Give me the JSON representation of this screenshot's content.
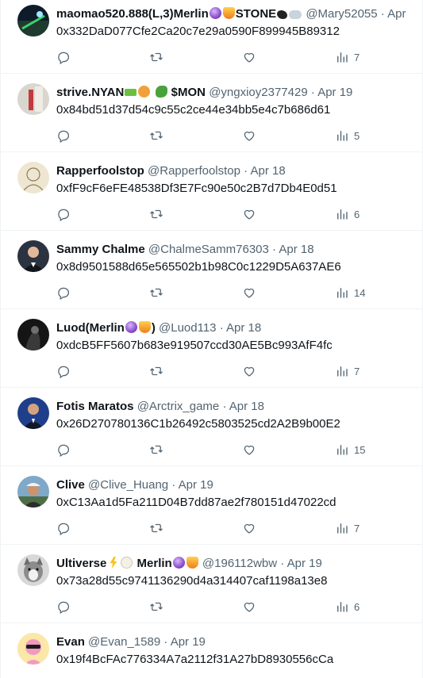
{
  "colors": {
    "text": "#0f1419",
    "secondary": "#536471",
    "divider": "#eff3f4"
  },
  "tweets": [
    {
      "name": "maomao520.888(L,3)Merlin",
      "emoji_after": [
        "purple-orb",
        "fire-wizard"
      ],
      "name_suffix": "STONE",
      "emoji_suffix": [
        "crow",
        "cloud"
      ],
      "handle": "@Mary52055",
      "sep": "·",
      "date": "Apr",
      "text": "0x332DaD077Cfe2Ca20c7e29a0590F899945B89312",
      "views": "7"
    },
    {
      "name": "strive.NYAN",
      "emoji_after": [
        "green-gun",
        "devil-face",
        "dragon"
      ],
      "name_suffix": "$MON",
      "emoji_suffix": [],
      "handle": "@yngxioy2377429",
      "sep": "·",
      "date": "Apr 19",
      "text": "0x84bd51d37d54c9c55c2ce44e34bb5e4c7b686d61",
      "views": "5"
    },
    {
      "name": "Rapperfoolstop",
      "emoji_after": [],
      "name_suffix": "",
      "emoji_suffix": [],
      "handle": "@Rapperfoolstop",
      "sep": "·",
      "date": "Apr 18",
      "text": "0xfF9cF6eFE48538Df3E7Fc90e50c2B7d7Db4E0d51",
      "views": "6"
    },
    {
      "name": "Sammy Chalme",
      "emoji_after": [],
      "name_suffix": "",
      "emoji_suffix": [],
      "handle": "@ChalmeSamm76303",
      "sep": "·",
      "date": "Apr 18",
      "text": "0x8d9501588d65e565502b1b98C0c1229D5A637AE6",
      "views": "14"
    },
    {
      "name": "Luod(Merlin",
      "emoji_after": [
        "purple-orb",
        "fire-wizard"
      ],
      "name_suffix": ")",
      "emoji_suffix": [],
      "handle": "@Luod113",
      "sep": "·",
      "date": "Apr 18",
      "text": "0xdcB5FF5607b683e919507ccd30AE5Bc993AfF4fc",
      "views": "7"
    },
    {
      "name": "Fotis Maratos",
      "emoji_after": [],
      "name_suffix": "",
      "emoji_suffix": [],
      "handle": "@Arctrix_game",
      "sep": "·",
      "date": "Apr 18",
      "text": "0x26D270780136C1b26492c5803525cd2A2B9b00E2",
      "views": "15"
    },
    {
      "name": "Clive",
      "emoji_after": [],
      "name_suffix": "",
      "emoji_suffix": [],
      "handle": "@Clive_Huang",
      "sep": "·",
      "date": "Apr 19",
      "text": "0xC13Aa1d5Fa211D04B7dd87ae2f780151d47022cd",
      "views": "7"
    },
    {
      "name": "Ultiverse",
      "emoji_after": [
        "lightning",
        "sheep"
      ],
      "name_suffix": "Merlin",
      "emoji_suffix": [
        "purple-orb",
        "fire-wizard"
      ],
      "handle": "@196112wbw",
      "sep": "·",
      "date": "Apr 19",
      "text": "0x73a28d55c9741136290d4a314407caf1198a13e8",
      "views": "6"
    },
    {
      "name": "Evan",
      "emoji_after": [],
      "name_suffix": "",
      "emoji_suffix": [],
      "handle": "@Evan_1589",
      "sep": "·",
      "date": "Apr 19",
      "text": "0x19f4BcFAc776334A7a2112f31A27bD8930556cCa",
      "views": ""
    }
  ],
  "icons": {
    "reply": "reply-icon",
    "retweet": "retweet-icon",
    "like": "heart-icon",
    "views": "views-icon"
  }
}
